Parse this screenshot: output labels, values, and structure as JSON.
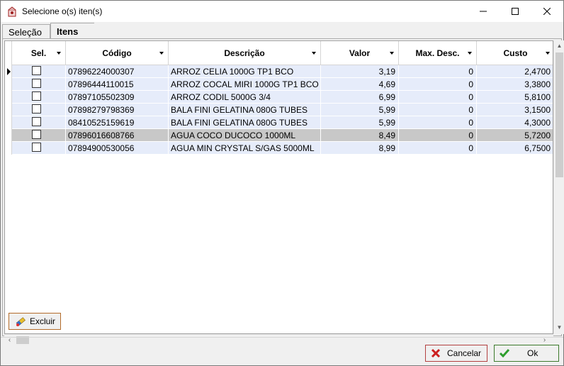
{
  "window": {
    "title": "Selecione o(s) iten(s)"
  },
  "tabs": [
    {
      "label": "Seleção"
    },
    {
      "label": "Itens"
    }
  ],
  "grid": {
    "columns": [
      "Sel.",
      "Código",
      "Descrição",
      "Valor",
      "Max. Desc.",
      "Custo"
    ],
    "rows": [
      {
        "codigo": "07896224000307",
        "descricao": "ARROZ CELIA 1000G TP1 BCO",
        "valor": "3,19",
        "max_desc": "0",
        "custo": "2,4700"
      },
      {
        "codigo": "07896444110015",
        "descricao": "ARROZ COCAL MIRI 1000G TP1 BCO",
        "valor": "4,69",
        "max_desc": "0",
        "custo": "3,3800"
      },
      {
        "codigo": "07897105502309",
        "descricao": "ARROZ CODIL 5000G 3/4",
        "valor": "6,99",
        "max_desc": "0",
        "custo": "5,8100"
      },
      {
        "codigo": "07898279798369",
        "descricao": "BALA FINI GELATINA 080G TUBES",
        "valor": "5,99",
        "max_desc": "0",
        "custo": "3,1500"
      },
      {
        "codigo": "08410525159619",
        "descricao": "BALA FINI GELATINA 080G TUBES",
        "valor": "5,99",
        "max_desc": "0",
        "custo": "4,3000"
      },
      {
        "codigo": "07896016608766",
        "descricao": "AGUA COCO DUCOCO 1000ML",
        "valor": "8,49",
        "max_desc": "0",
        "custo": "5,7200"
      },
      {
        "codigo": "07894900530056",
        "descricao": "AGUA MIN CRYSTAL S/GAS 5000ML",
        "valor": "8,99",
        "max_desc": "0",
        "custo": "6,7500"
      }
    ]
  },
  "buttons": {
    "excluir": "Excluir",
    "cancelar": "Cancelar",
    "ok": "Ok"
  },
  "colors": {
    "row_bg": "#e6ecfa",
    "selected_row_bg": "#c8c8c8",
    "excluir_border": "#b36c2a",
    "cancel_icon": "#cc2020",
    "ok_icon": "#2e9e2e"
  },
  "icons": {
    "app": "package-app-icon",
    "excluir": "eraser-icon",
    "cancelar": "red-x-icon",
    "ok": "green-check-icon"
  }
}
